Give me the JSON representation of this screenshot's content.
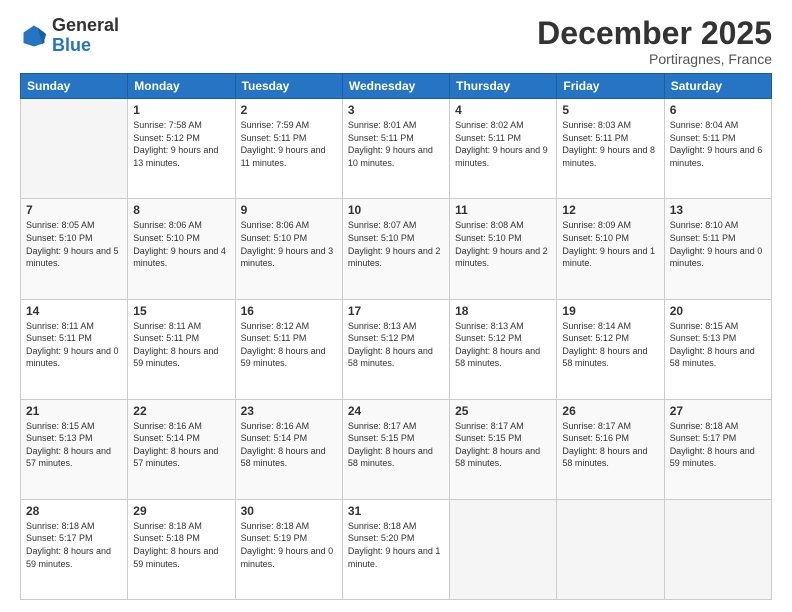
{
  "logo": {
    "general": "General",
    "blue": "Blue"
  },
  "header": {
    "month": "December 2025",
    "location": "Portiragnes, France"
  },
  "days_of_week": [
    "Sunday",
    "Monday",
    "Tuesday",
    "Wednesday",
    "Thursday",
    "Friday",
    "Saturday"
  ],
  "weeks": [
    [
      {
        "day": "",
        "empty": true
      },
      {
        "day": "1",
        "sunrise": "7:58 AM",
        "sunset": "5:12 PM",
        "daylight": "9 hours and 13 minutes."
      },
      {
        "day": "2",
        "sunrise": "7:59 AM",
        "sunset": "5:11 PM",
        "daylight": "9 hours and 11 minutes."
      },
      {
        "day": "3",
        "sunrise": "8:01 AM",
        "sunset": "5:11 PM",
        "daylight": "9 hours and 10 minutes."
      },
      {
        "day": "4",
        "sunrise": "8:02 AM",
        "sunset": "5:11 PM",
        "daylight": "9 hours and 9 minutes."
      },
      {
        "day": "5",
        "sunrise": "8:03 AM",
        "sunset": "5:11 PM",
        "daylight": "9 hours and 8 minutes."
      },
      {
        "day": "6",
        "sunrise": "8:04 AM",
        "sunset": "5:11 PM",
        "daylight": "9 hours and 6 minutes."
      }
    ],
    [
      {
        "day": "7",
        "sunrise": "8:05 AM",
        "sunset": "5:10 PM",
        "daylight": "9 hours and 5 minutes."
      },
      {
        "day": "8",
        "sunrise": "8:06 AM",
        "sunset": "5:10 PM",
        "daylight": "9 hours and 4 minutes."
      },
      {
        "day": "9",
        "sunrise": "8:06 AM",
        "sunset": "5:10 PM",
        "daylight": "9 hours and 3 minutes."
      },
      {
        "day": "10",
        "sunrise": "8:07 AM",
        "sunset": "5:10 PM",
        "daylight": "9 hours and 2 minutes."
      },
      {
        "day": "11",
        "sunrise": "8:08 AM",
        "sunset": "5:10 PM",
        "daylight": "9 hours and 2 minutes."
      },
      {
        "day": "12",
        "sunrise": "8:09 AM",
        "sunset": "5:10 PM",
        "daylight": "9 hours and 1 minute."
      },
      {
        "day": "13",
        "sunrise": "8:10 AM",
        "sunset": "5:11 PM",
        "daylight": "9 hours and 0 minutes."
      }
    ],
    [
      {
        "day": "14",
        "sunrise": "8:11 AM",
        "sunset": "5:11 PM",
        "daylight": "9 hours and 0 minutes."
      },
      {
        "day": "15",
        "sunrise": "8:11 AM",
        "sunset": "5:11 PM",
        "daylight": "8 hours and 59 minutes."
      },
      {
        "day": "16",
        "sunrise": "8:12 AM",
        "sunset": "5:11 PM",
        "daylight": "8 hours and 59 minutes."
      },
      {
        "day": "17",
        "sunrise": "8:13 AM",
        "sunset": "5:12 PM",
        "daylight": "8 hours and 58 minutes."
      },
      {
        "day": "18",
        "sunrise": "8:13 AM",
        "sunset": "5:12 PM",
        "daylight": "8 hours and 58 minutes."
      },
      {
        "day": "19",
        "sunrise": "8:14 AM",
        "sunset": "5:12 PM",
        "daylight": "8 hours and 58 minutes."
      },
      {
        "day": "20",
        "sunrise": "8:15 AM",
        "sunset": "5:13 PM",
        "daylight": "8 hours and 58 minutes."
      }
    ],
    [
      {
        "day": "21",
        "sunrise": "8:15 AM",
        "sunset": "5:13 PM",
        "daylight": "8 hours and 57 minutes."
      },
      {
        "day": "22",
        "sunrise": "8:16 AM",
        "sunset": "5:14 PM",
        "daylight": "8 hours and 57 minutes."
      },
      {
        "day": "23",
        "sunrise": "8:16 AM",
        "sunset": "5:14 PM",
        "daylight": "8 hours and 58 minutes."
      },
      {
        "day": "24",
        "sunrise": "8:17 AM",
        "sunset": "5:15 PM",
        "daylight": "8 hours and 58 minutes."
      },
      {
        "day": "25",
        "sunrise": "8:17 AM",
        "sunset": "5:15 PM",
        "daylight": "8 hours and 58 minutes."
      },
      {
        "day": "26",
        "sunrise": "8:17 AM",
        "sunset": "5:16 PM",
        "daylight": "8 hours and 58 minutes."
      },
      {
        "day": "27",
        "sunrise": "8:18 AM",
        "sunset": "5:17 PM",
        "daylight": "8 hours and 59 minutes."
      }
    ],
    [
      {
        "day": "28",
        "sunrise": "8:18 AM",
        "sunset": "5:17 PM",
        "daylight": "8 hours and 59 minutes."
      },
      {
        "day": "29",
        "sunrise": "8:18 AM",
        "sunset": "5:18 PM",
        "daylight": "8 hours and 59 minutes."
      },
      {
        "day": "30",
        "sunrise": "8:18 AM",
        "sunset": "5:19 PM",
        "daylight": "9 hours and 0 minutes."
      },
      {
        "day": "31",
        "sunrise": "8:18 AM",
        "sunset": "5:20 PM",
        "daylight": "9 hours and 1 minute."
      },
      {
        "day": "",
        "empty": true
      },
      {
        "day": "",
        "empty": true
      },
      {
        "day": "",
        "empty": true
      }
    ]
  ]
}
